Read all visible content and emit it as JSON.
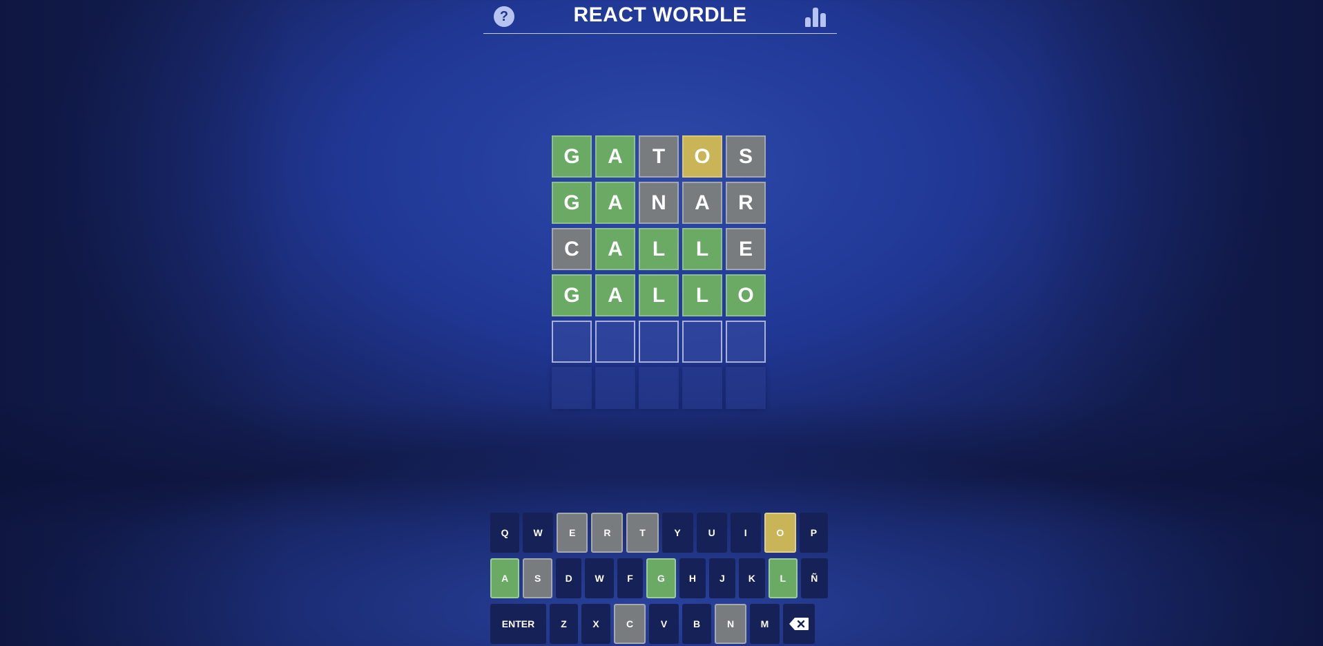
{
  "header": {
    "title": "REACT WORDLE",
    "help_label": "?"
  },
  "board": {
    "rows": [
      [
        {
          "l": "G",
          "s": "green"
        },
        {
          "l": "A",
          "s": "green"
        },
        {
          "l": "T",
          "s": "gray"
        },
        {
          "l": "O",
          "s": "yellow"
        },
        {
          "l": "S",
          "s": "gray"
        }
      ],
      [
        {
          "l": "G",
          "s": "green"
        },
        {
          "l": "A",
          "s": "green"
        },
        {
          "l": "N",
          "s": "gray"
        },
        {
          "l": "A",
          "s": "gray"
        },
        {
          "l": "R",
          "s": "gray"
        }
      ],
      [
        {
          "l": "C",
          "s": "gray"
        },
        {
          "l": "A",
          "s": "green"
        },
        {
          "l": "L",
          "s": "green"
        },
        {
          "l": "L",
          "s": "green"
        },
        {
          "l": "E",
          "s": "gray"
        }
      ],
      [
        {
          "l": "G",
          "s": "green"
        },
        {
          "l": "A",
          "s": "green"
        },
        {
          "l": "L",
          "s": "green"
        },
        {
          "l": "L",
          "s": "green"
        },
        {
          "l": "O",
          "s": "green"
        }
      ],
      [
        {
          "l": "",
          "s": "empty"
        },
        {
          "l": "",
          "s": "empty"
        },
        {
          "l": "",
          "s": "empty"
        },
        {
          "l": "",
          "s": "empty"
        },
        {
          "l": "",
          "s": "empty"
        }
      ],
      [
        {
          "l": "",
          "s": "blank"
        },
        {
          "l": "",
          "s": "blank"
        },
        {
          "l": "",
          "s": "blank"
        },
        {
          "l": "",
          "s": "blank"
        },
        {
          "l": "",
          "s": "blank"
        }
      ]
    ]
  },
  "keyboard": {
    "rows": [
      [
        {
          "k": "Q",
          "s": ""
        },
        {
          "k": "W",
          "s": ""
        },
        {
          "k": "E",
          "s": "gray"
        },
        {
          "k": "R",
          "s": "gray"
        },
        {
          "k": "T",
          "s": "gray"
        },
        {
          "k": "Y",
          "s": ""
        },
        {
          "k": "U",
          "s": ""
        },
        {
          "k": "I",
          "s": ""
        },
        {
          "k": "O",
          "s": "yellow"
        },
        {
          "k": "P",
          "s": ""
        }
      ],
      [
        {
          "k": "A",
          "s": "green"
        },
        {
          "k": "S",
          "s": "gray"
        },
        {
          "k": "D",
          "s": ""
        },
        {
          "k": "W",
          "s": ""
        },
        {
          "k": "F",
          "s": ""
        },
        {
          "k": "G",
          "s": "green"
        },
        {
          "k": "H",
          "s": ""
        },
        {
          "k": "J",
          "s": ""
        },
        {
          "k": "K",
          "s": ""
        },
        {
          "k": "L",
          "s": "green"
        },
        {
          "k": "Ñ",
          "s": ""
        }
      ],
      [
        {
          "k": "ENTER",
          "s": "",
          "wide": true
        },
        {
          "k": "Z",
          "s": ""
        },
        {
          "k": "X",
          "s": ""
        },
        {
          "k": "C",
          "s": "gray"
        },
        {
          "k": "V",
          "s": ""
        },
        {
          "k": "B",
          "s": ""
        },
        {
          "k": "N",
          "s": "gray"
        },
        {
          "k": "M",
          "s": ""
        },
        {
          "k": "",
          "s": "",
          "icon": "backspace-icon"
        }
      ]
    ]
  },
  "colors": {
    "green": "#6aaa64",
    "yellow": "#c9b458",
    "gray": "#787c7e",
    "key_default": "#162158",
    "background": "#2640a0"
  }
}
